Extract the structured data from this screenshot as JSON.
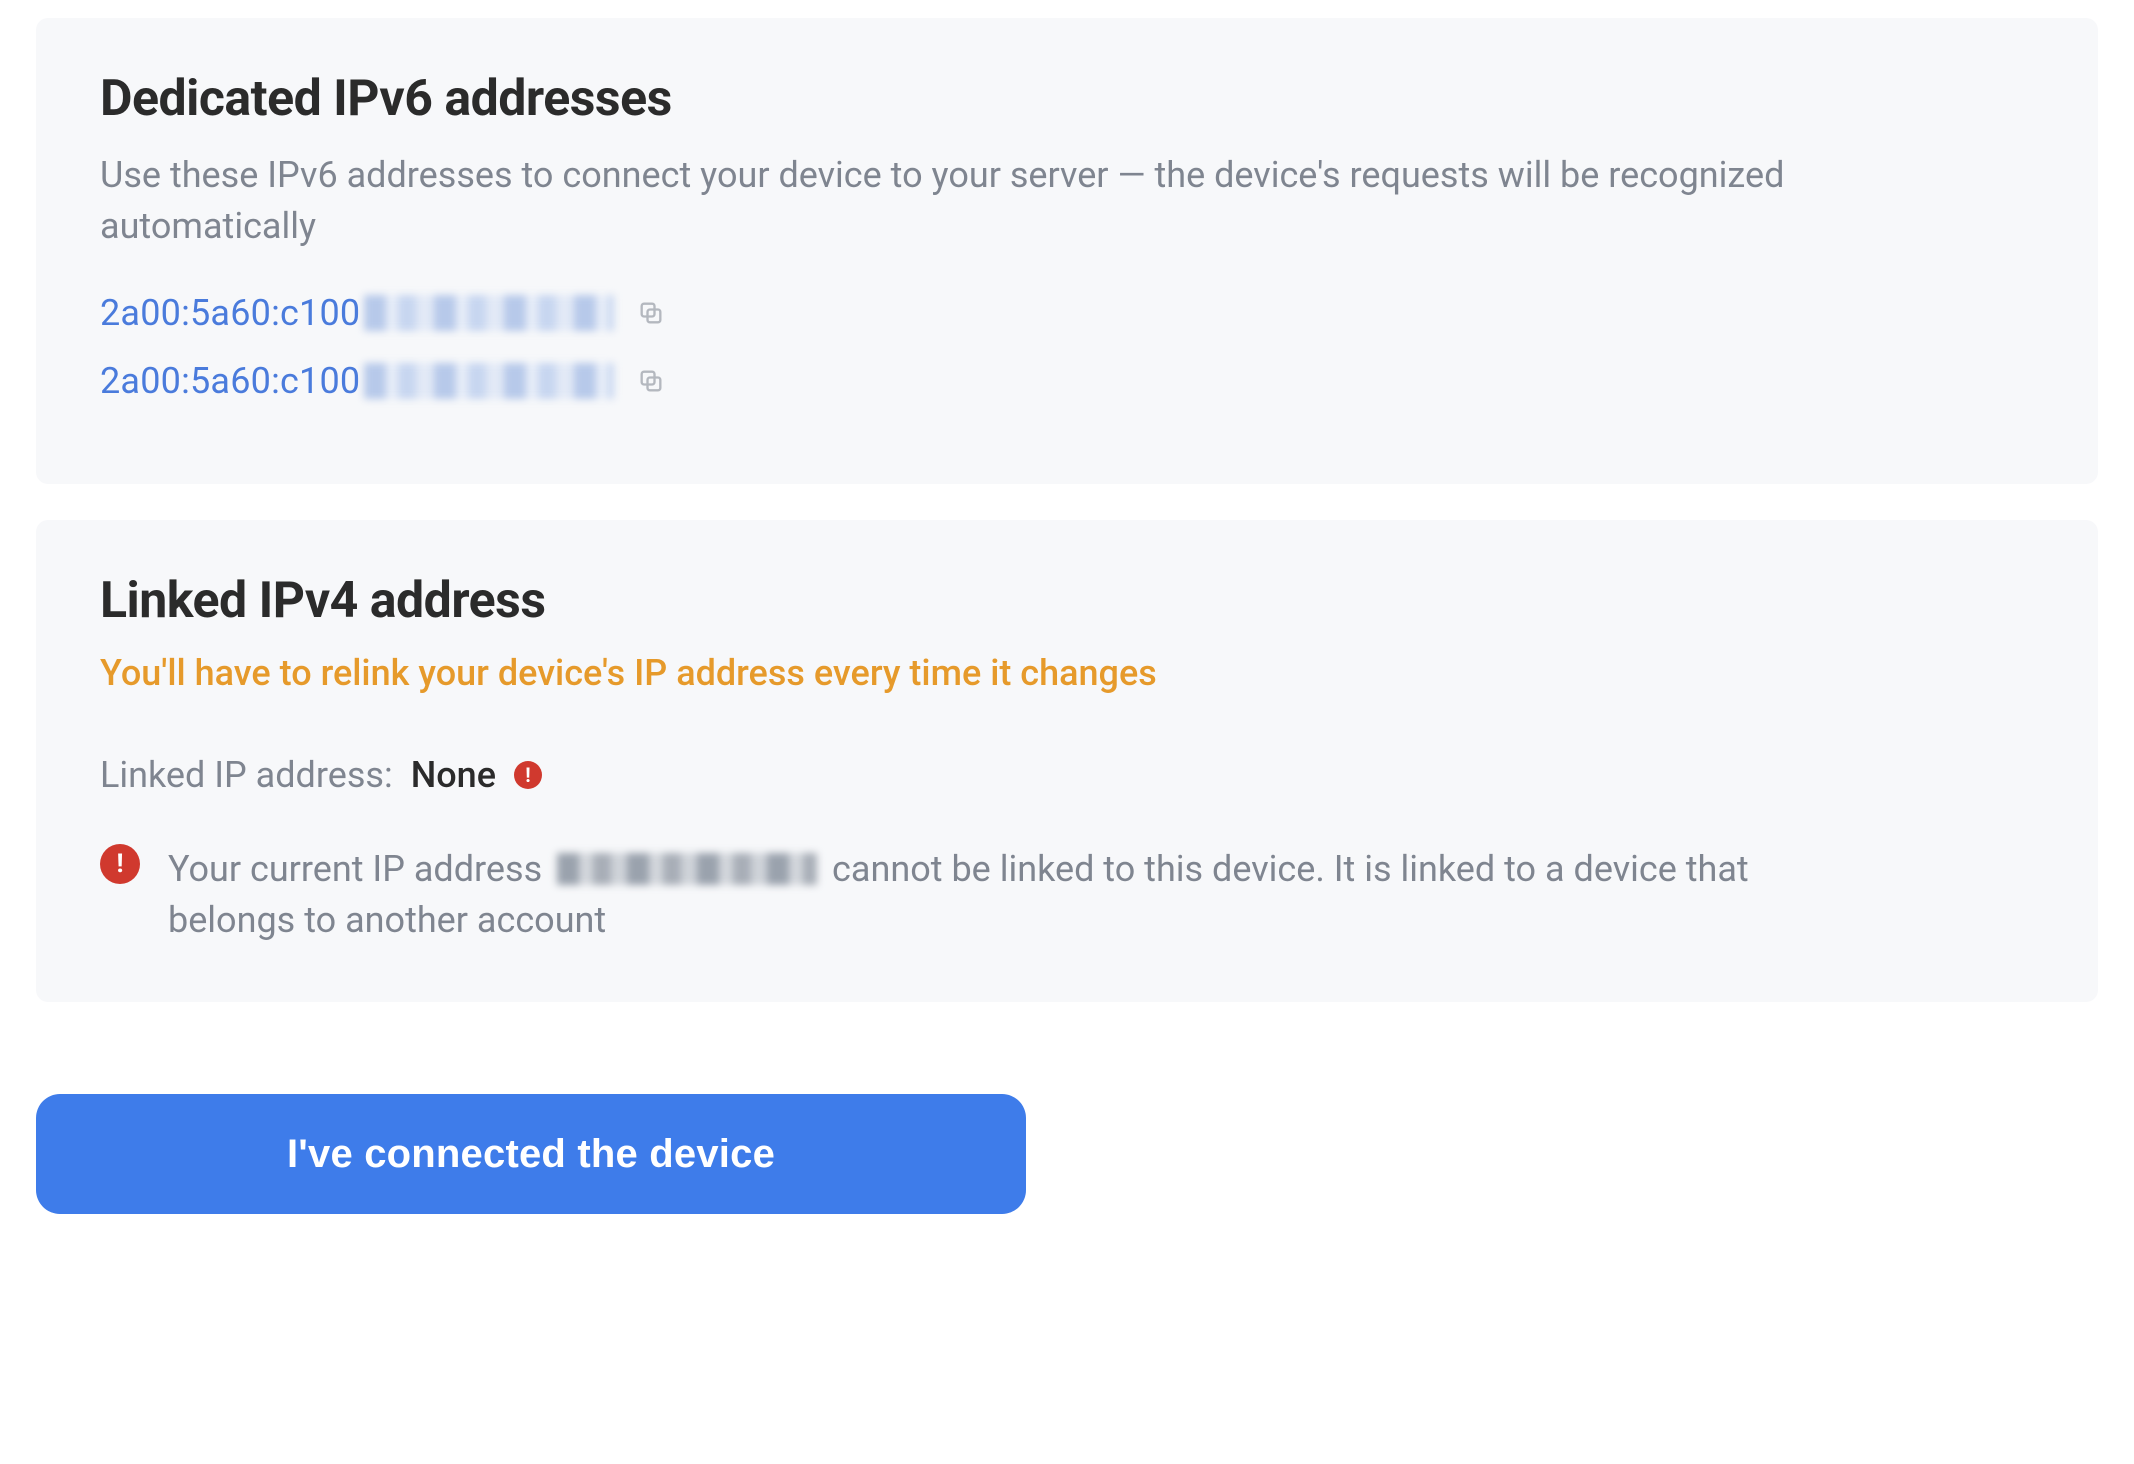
{
  "ipv6": {
    "title": "Dedicated IPv6 addresses",
    "description": "Use these IPv6 addresses to connect your device to your server — the device's requests will be recognized automatically",
    "addresses": [
      {
        "prefix": "2a00:5a60:c100"
      },
      {
        "prefix": "2a00:5a60:c100"
      }
    ]
  },
  "ipv4": {
    "title": "Linked IPv4 address",
    "warning": "You'll have to relink your device's IP address every time it changes",
    "linked_label": "Linked IP address:",
    "linked_value": "None",
    "error_prefix": "Your current IP address",
    "error_suffix": "cannot be linked to this device. It is linked to a device that belongs to another account"
  },
  "cta_label": "I've connected the device"
}
